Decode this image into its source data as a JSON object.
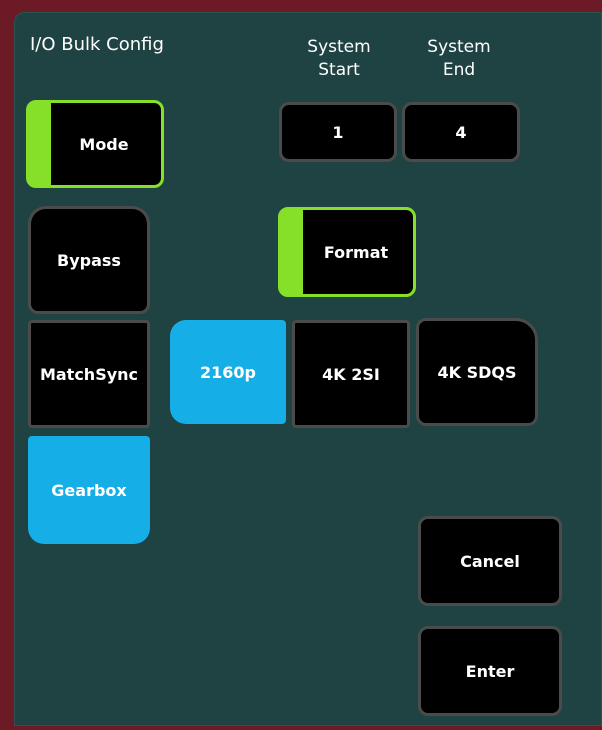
{
  "title": "I/O Bulk Config",
  "columns": {
    "system_start": "System\nStart",
    "system_end": "System\nEnd"
  },
  "fields": {
    "system_start_value": "1",
    "system_end_value": "4"
  },
  "mode": {
    "label": "Mode",
    "options": [
      "Bypass",
      "MatchSync",
      "Gearbox"
    ],
    "selected": "Gearbox"
  },
  "format": {
    "label": "Format",
    "options": [
      "2160p",
      "4K 2SI",
      "4K SDQS"
    ],
    "selected": "2160p"
  },
  "actions": {
    "cancel": "Cancel",
    "enter": "Enter"
  },
  "colors": {
    "background": "#1f4242",
    "frame": "#6b1a26",
    "active_green": "#86e02a",
    "selected_blue": "#16aee6",
    "button_black": "#000000"
  }
}
